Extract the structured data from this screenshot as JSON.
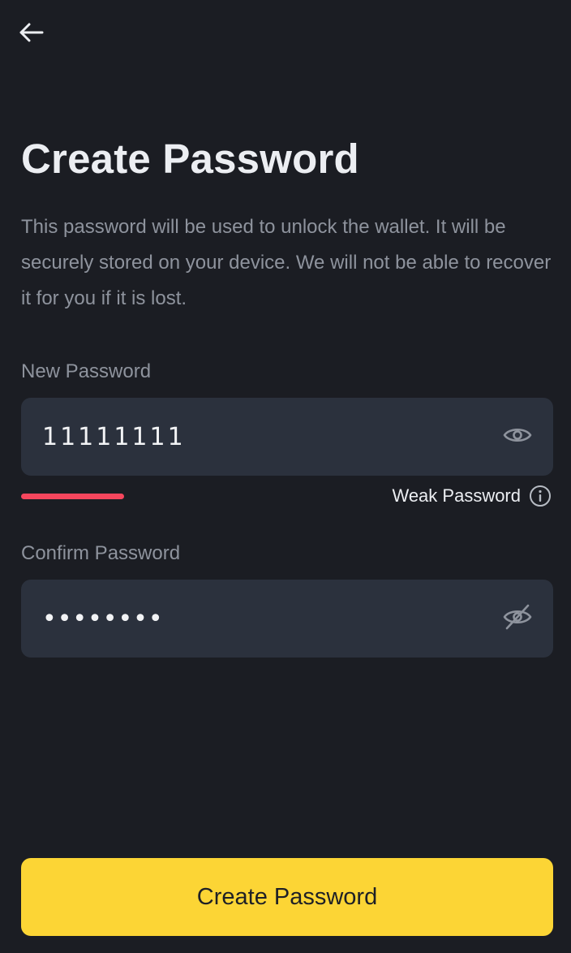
{
  "header": {
    "back_icon": "arrow-left-icon"
  },
  "page": {
    "title": "Create Password",
    "description": "This password will be used to unlock the wallet. It will be securely stored on your device. We will not be able to recover it for you if it is lost."
  },
  "new_password": {
    "label": "New Password",
    "value": "11111111",
    "visibility_icon": "eye-icon",
    "strength": {
      "text": "Weak Password",
      "color": "#f6465d",
      "level": 0.2,
      "info_icon": "info-circle-icon"
    }
  },
  "confirm_password": {
    "label": "Confirm Password",
    "value": "••••••••",
    "visibility_icon": "eye-off-icon"
  },
  "footer": {
    "submit_label": "Create Password"
  },
  "colors": {
    "background": "#1b1d23",
    "input_background": "#2b313d",
    "accent": "#fcd535",
    "muted_text": "#8e939d",
    "danger": "#f6465d"
  }
}
